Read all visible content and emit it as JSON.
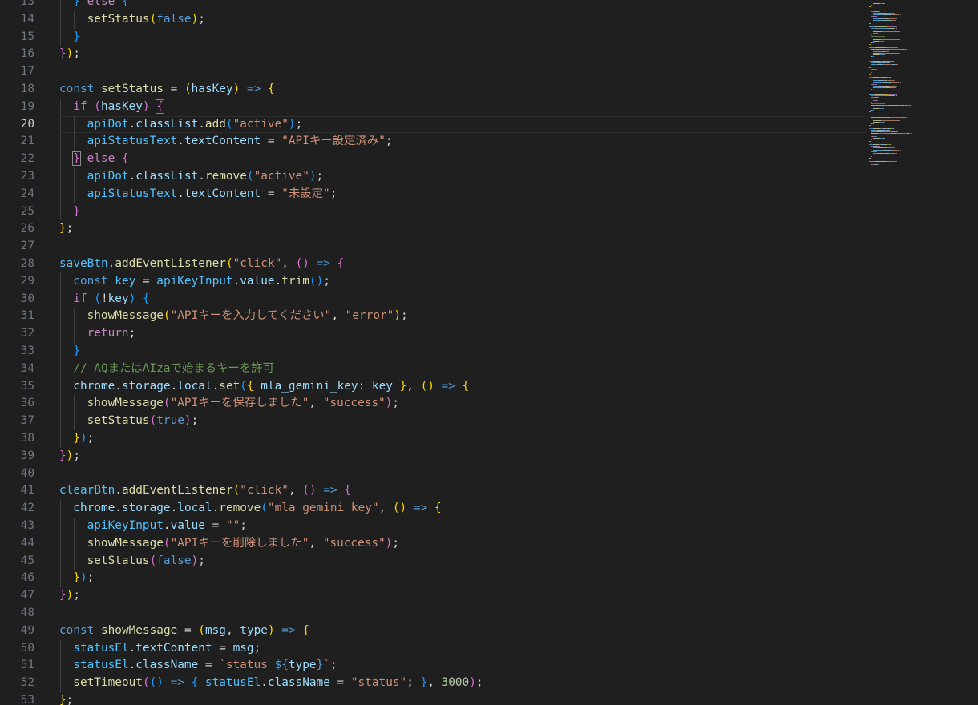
{
  "editor": {
    "first_line_number": 13,
    "active_line_number": 20,
    "colors": {
      "background": "#1f1f1f",
      "line_number": "#6e7681",
      "line_number_active": "#cccccc",
      "keyword": "#569cd6",
      "control": "#c586c0",
      "variable": "#9cdcfe",
      "constant": "#4fc1ff",
      "function": "#dcdcaa",
      "string": "#ce9178",
      "number": "#b5cea8",
      "comment": "#6a9955",
      "bracket_1": "#ffd700",
      "bracket_2": "#da70d6",
      "bracket_3": "#179fff"
    },
    "lines": [
      {
        "n": "13",
        "indent": 1,
        "t": [
          [
            "b3",
            "} "
          ],
          [
            "ctl",
            "else "
          ],
          [
            "b3",
            "{"
          ]
        ]
      },
      {
        "n": "14",
        "indent": 2,
        "t": [
          [
            "fn",
            "setStatus"
          ],
          [
            "b1",
            "("
          ],
          [
            "kw",
            "false"
          ],
          [
            "b1",
            ")"
          ],
          [
            "tx",
            ";"
          ]
        ]
      },
      {
        "n": "15",
        "indent": 1,
        "t": [
          [
            "b3",
            "}"
          ]
        ]
      },
      {
        "n": "16",
        "indent": 0,
        "t": [
          [
            "b2",
            "}"
          ],
          [
            "b1",
            ")"
          ],
          [
            "tx",
            ";"
          ]
        ]
      },
      {
        "n": "17",
        "indent": 0,
        "t": []
      },
      {
        "n": "18",
        "indent": 0,
        "t": [
          [
            "kw",
            "const "
          ],
          [
            "fn",
            "setStatus"
          ],
          [
            "tx",
            " = "
          ],
          [
            "b1",
            "("
          ],
          [
            "var",
            "hasKey"
          ],
          [
            "b1",
            ")"
          ],
          [
            "kw",
            " => "
          ],
          [
            "b1",
            "{"
          ]
        ]
      },
      {
        "n": "19",
        "indent": 1,
        "t": [
          [
            "ctl",
            "if "
          ],
          [
            "b2",
            "("
          ],
          [
            "var",
            "hasKey"
          ],
          [
            "b2",
            ")"
          ],
          [
            "tx",
            " "
          ],
          [
            "b2",
            "{",
            "bm"
          ]
        ]
      },
      {
        "n": "20",
        "indent": 2,
        "t": [
          [
            "const",
            "apiDot"
          ],
          [
            "tx",
            "."
          ],
          [
            "var",
            "classList"
          ],
          [
            "tx",
            "."
          ],
          [
            "fn",
            "add"
          ],
          [
            "b3",
            "("
          ],
          [
            "str",
            "\"active\""
          ],
          [
            "b3",
            ")"
          ],
          [
            "tx",
            ";"
          ]
        ]
      },
      {
        "n": "21",
        "indent": 2,
        "t": [
          [
            "const",
            "apiStatusText"
          ],
          [
            "tx",
            "."
          ],
          [
            "var",
            "textContent"
          ],
          [
            "tx",
            " = "
          ],
          [
            "str",
            "\"APIキー設定済み\""
          ],
          [
            "tx",
            ";"
          ]
        ]
      },
      {
        "n": "22",
        "indent": 1,
        "t": [
          [
            "b2",
            "}",
            "bm"
          ],
          [
            "ctl",
            " else "
          ],
          [
            "b2",
            "{"
          ]
        ]
      },
      {
        "n": "23",
        "indent": 2,
        "t": [
          [
            "const",
            "apiDot"
          ],
          [
            "tx",
            "."
          ],
          [
            "var",
            "classList"
          ],
          [
            "tx",
            "."
          ],
          [
            "fn",
            "remove"
          ],
          [
            "b3",
            "("
          ],
          [
            "str",
            "\"active\""
          ],
          [
            "b3",
            ")"
          ],
          [
            "tx",
            ";"
          ]
        ]
      },
      {
        "n": "24",
        "indent": 2,
        "t": [
          [
            "const",
            "apiStatusText"
          ],
          [
            "tx",
            "."
          ],
          [
            "var",
            "textContent"
          ],
          [
            "tx",
            " = "
          ],
          [
            "str",
            "\"未設定\""
          ],
          [
            "tx",
            ";"
          ]
        ]
      },
      {
        "n": "25",
        "indent": 1,
        "t": [
          [
            "b2",
            "}"
          ]
        ]
      },
      {
        "n": "26",
        "indent": 0,
        "t": [
          [
            "b1",
            "}"
          ],
          [
            "tx",
            ";"
          ]
        ]
      },
      {
        "n": "27",
        "indent": 0,
        "t": []
      },
      {
        "n": "28",
        "indent": 0,
        "t": [
          [
            "const",
            "saveBtn"
          ],
          [
            "tx",
            "."
          ],
          [
            "fn",
            "addEventListener"
          ],
          [
            "b1",
            "("
          ],
          [
            "str",
            "\"click\""
          ],
          [
            "tx",
            ", "
          ],
          [
            "b2",
            "()"
          ],
          [
            "kw",
            " => "
          ],
          [
            "b2",
            "{"
          ]
        ]
      },
      {
        "n": "29",
        "indent": 1,
        "t": [
          [
            "kw",
            "const "
          ],
          [
            "const",
            "key"
          ],
          [
            "tx",
            " = "
          ],
          [
            "const",
            "apiKeyInput"
          ],
          [
            "tx",
            "."
          ],
          [
            "var",
            "value"
          ],
          [
            "tx",
            "."
          ],
          [
            "fn",
            "trim"
          ],
          [
            "b3",
            "()"
          ],
          [
            "tx",
            ";"
          ]
        ]
      },
      {
        "n": "30",
        "indent": 1,
        "t": [
          [
            "ctl",
            "if "
          ],
          [
            "b3",
            "("
          ],
          [
            "tx",
            "!"
          ],
          [
            "var",
            "key"
          ],
          [
            "b3",
            ")"
          ],
          [
            "tx",
            " "
          ],
          [
            "b3",
            "{"
          ]
        ]
      },
      {
        "n": "31",
        "indent": 2,
        "t": [
          [
            "fn",
            "showMessage"
          ],
          [
            "b1",
            "("
          ],
          [
            "str",
            "\"APIキーを入力してください\""
          ],
          [
            "tx",
            ", "
          ],
          [
            "str",
            "\"error\""
          ],
          [
            "b1",
            ")"
          ],
          [
            "tx",
            ";"
          ]
        ]
      },
      {
        "n": "32",
        "indent": 2,
        "t": [
          [
            "ctl",
            "return"
          ],
          [
            "tx",
            ";"
          ]
        ]
      },
      {
        "n": "33",
        "indent": 1,
        "t": [
          [
            "b3",
            "}"
          ]
        ]
      },
      {
        "n": "34",
        "indent": 1,
        "t": [
          [
            "cmt",
            "// AQまたはAIzaで始まるキーを許可"
          ]
        ]
      },
      {
        "n": "35",
        "indent": 1,
        "t": [
          [
            "var",
            "chrome"
          ],
          [
            "tx",
            "."
          ],
          [
            "var",
            "storage"
          ],
          [
            "tx",
            "."
          ],
          [
            "var",
            "local"
          ],
          [
            "tx",
            "."
          ],
          [
            "fn",
            "set"
          ],
          [
            "b3",
            "("
          ],
          [
            "b1",
            "{ "
          ],
          [
            "var",
            "mla_gemini_key"
          ],
          [
            "tx",
            ": "
          ],
          [
            "var",
            "key"
          ],
          [
            "b1",
            " }"
          ],
          [
            "tx",
            ", "
          ],
          [
            "b1",
            "()"
          ],
          [
            "kw",
            " => "
          ],
          [
            "b1",
            "{"
          ]
        ]
      },
      {
        "n": "36",
        "indent": 2,
        "t": [
          [
            "fn",
            "showMessage"
          ],
          [
            "b2",
            "("
          ],
          [
            "str",
            "\"APIキーを保存しました\""
          ],
          [
            "tx",
            ", "
          ],
          [
            "str",
            "\"success\""
          ],
          [
            "b2",
            ")"
          ],
          [
            "tx",
            ";"
          ]
        ]
      },
      {
        "n": "37",
        "indent": 2,
        "t": [
          [
            "fn",
            "setStatus"
          ],
          [
            "b2",
            "("
          ],
          [
            "kw",
            "true"
          ],
          [
            "b2",
            ")"
          ],
          [
            "tx",
            ";"
          ]
        ]
      },
      {
        "n": "38",
        "indent": 1,
        "t": [
          [
            "b1",
            "}"
          ],
          [
            "b3",
            ")"
          ],
          [
            "tx",
            ";"
          ]
        ]
      },
      {
        "n": "39",
        "indent": 0,
        "t": [
          [
            "b2",
            "}"
          ],
          [
            "b1",
            ")"
          ],
          [
            "tx",
            ";"
          ]
        ]
      },
      {
        "n": "40",
        "indent": 0,
        "t": []
      },
      {
        "n": "41",
        "indent": 0,
        "t": [
          [
            "const",
            "clearBtn"
          ],
          [
            "tx",
            "."
          ],
          [
            "fn",
            "addEventListener"
          ],
          [
            "b1",
            "("
          ],
          [
            "str",
            "\"click\""
          ],
          [
            "tx",
            ", "
          ],
          [
            "b2",
            "()"
          ],
          [
            "kw",
            " => "
          ],
          [
            "b2",
            "{"
          ]
        ]
      },
      {
        "n": "42",
        "indent": 1,
        "t": [
          [
            "var",
            "chrome"
          ],
          [
            "tx",
            "."
          ],
          [
            "var",
            "storage"
          ],
          [
            "tx",
            "."
          ],
          [
            "var",
            "local"
          ],
          [
            "tx",
            "."
          ],
          [
            "fn",
            "remove"
          ],
          [
            "b3",
            "("
          ],
          [
            "str",
            "\"mla_gemini_key\""
          ],
          [
            "tx",
            ", "
          ],
          [
            "b1",
            "()"
          ],
          [
            "kw",
            " => "
          ],
          [
            "b1",
            "{"
          ]
        ]
      },
      {
        "n": "43",
        "indent": 2,
        "t": [
          [
            "const",
            "apiKeyInput"
          ],
          [
            "tx",
            "."
          ],
          [
            "var",
            "value"
          ],
          [
            "tx",
            " = "
          ],
          [
            "str",
            "\"\""
          ],
          [
            "tx",
            ";"
          ]
        ]
      },
      {
        "n": "44",
        "indent": 2,
        "t": [
          [
            "fn",
            "showMessage"
          ],
          [
            "b2",
            "("
          ],
          [
            "str",
            "\"APIキーを削除しました\""
          ],
          [
            "tx",
            ", "
          ],
          [
            "str",
            "\"success\""
          ],
          [
            "b2",
            ")"
          ],
          [
            "tx",
            ";"
          ]
        ]
      },
      {
        "n": "45",
        "indent": 2,
        "t": [
          [
            "fn",
            "setStatus"
          ],
          [
            "b2",
            "("
          ],
          [
            "kw",
            "false"
          ],
          [
            "b2",
            ")"
          ],
          [
            "tx",
            ";"
          ]
        ]
      },
      {
        "n": "46",
        "indent": 1,
        "t": [
          [
            "b1",
            "}"
          ],
          [
            "b3",
            ")"
          ],
          [
            "tx",
            ";"
          ]
        ]
      },
      {
        "n": "47",
        "indent": 0,
        "t": [
          [
            "b2",
            "}"
          ],
          [
            "b1",
            ")"
          ],
          [
            "tx",
            ";"
          ]
        ]
      },
      {
        "n": "48",
        "indent": 0,
        "t": []
      },
      {
        "n": "49",
        "indent": 0,
        "t": [
          [
            "kw",
            "const "
          ],
          [
            "fn",
            "showMessage"
          ],
          [
            "tx",
            " = "
          ],
          [
            "b1",
            "("
          ],
          [
            "var",
            "msg"
          ],
          [
            "tx",
            ", "
          ],
          [
            "var",
            "type"
          ],
          [
            "b1",
            ")"
          ],
          [
            "kw",
            " => "
          ],
          [
            "b1",
            "{"
          ]
        ]
      },
      {
        "n": "50",
        "indent": 1,
        "t": [
          [
            "const",
            "statusEl"
          ],
          [
            "tx",
            "."
          ],
          [
            "var",
            "textContent"
          ],
          [
            "tx",
            " = "
          ],
          [
            "var",
            "msg"
          ],
          [
            "tx",
            ";"
          ]
        ]
      },
      {
        "n": "51",
        "indent": 1,
        "t": [
          [
            "const",
            "statusEl"
          ],
          [
            "tx",
            "."
          ],
          [
            "var",
            "className"
          ],
          [
            "tx",
            " = "
          ],
          [
            "str",
            "`status "
          ],
          [
            "kw",
            "${"
          ],
          [
            "var",
            "type"
          ],
          [
            "kw",
            "}"
          ],
          [
            "str",
            "`"
          ],
          [
            "tx",
            ";"
          ]
        ]
      },
      {
        "n": "52",
        "indent": 1,
        "t": [
          [
            "fn",
            "setTimeout"
          ],
          [
            "b2",
            "("
          ],
          [
            "b3",
            "()"
          ],
          [
            "kw",
            " => "
          ],
          [
            "b3",
            "{ "
          ],
          [
            "const",
            "statusEl"
          ],
          [
            "tx",
            "."
          ],
          [
            "var",
            "className"
          ],
          [
            "tx",
            " = "
          ],
          [
            "str",
            "\"status\""
          ],
          [
            "tx",
            "; "
          ],
          [
            "b3",
            "}"
          ],
          [
            "tx",
            ", "
          ],
          [
            "num",
            "3000"
          ],
          [
            "b2",
            ")"
          ],
          [
            "tx",
            ";"
          ]
        ]
      },
      {
        "n": "53",
        "indent": 0,
        "t": [
          [
            "b1",
            "}"
          ],
          [
            "tx",
            ";"
          ]
        ]
      }
    ]
  }
}
